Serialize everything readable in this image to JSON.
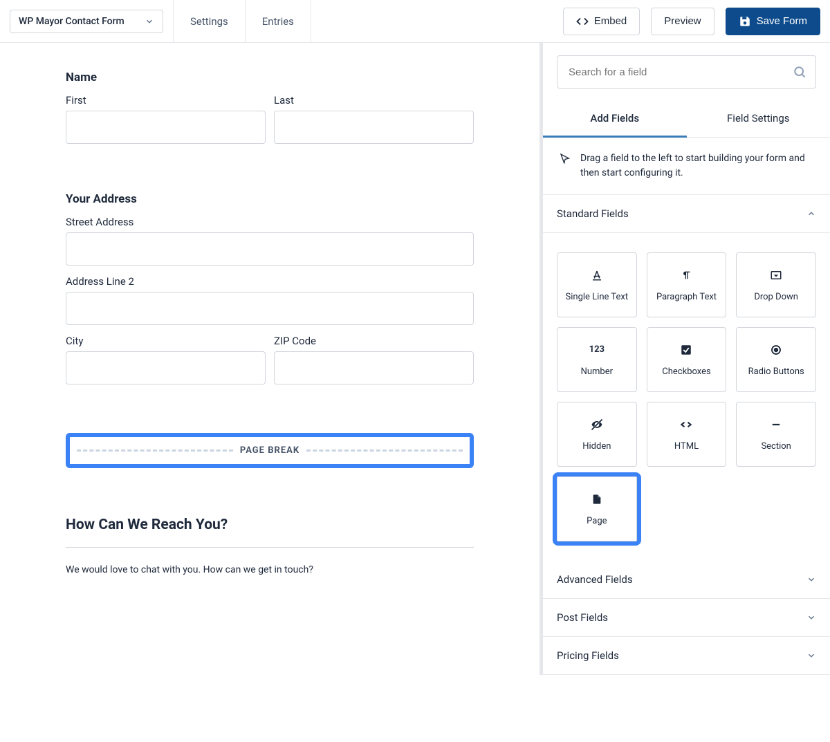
{
  "header": {
    "form_name": "WP Mayor Contact Form",
    "tabs": {
      "settings": "Settings",
      "entries": "Entries"
    },
    "buttons": {
      "embed": "Embed",
      "preview": "Preview",
      "save": "Save Form"
    }
  },
  "canvas": {
    "name": {
      "title": "Name",
      "first": "First",
      "last": "Last"
    },
    "address": {
      "title": "Your Address",
      "street": "Street Address",
      "line2": "Address Line 2",
      "city": "City",
      "zip": "ZIP Code"
    },
    "page_break": "PAGE BREAK",
    "section": {
      "title": "How Can We Reach You?",
      "desc": "We would love to chat with you. How can we get in touch?"
    }
  },
  "sidebar": {
    "search_placeholder": "Search for a field",
    "tabs": {
      "add": "Add Fields",
      "settings": "Field Settings"
    },
    "hint": "Drag a field to the left to start building your form and then start configuring it.",
    "groups": {
      "standard": "Standard Fields",
      "advanced": "Advanced Fields",
      "post": "Post Fields",
      "pricing": "Pricing Fields"
    },
    "fields": {
      "single_line": "Single Line Text",
      "paragraph": "Paragraph Text",
      "dropdown": "Drop Down",
      "number": "Number",
      "checkboxes": "Checkboxes",
      "radio": "Radio Buttons",
      "hidden": "Hidden",
      "html": "HTML",
      "section": "Section",
      "page": "Page"
    }
  }
}
